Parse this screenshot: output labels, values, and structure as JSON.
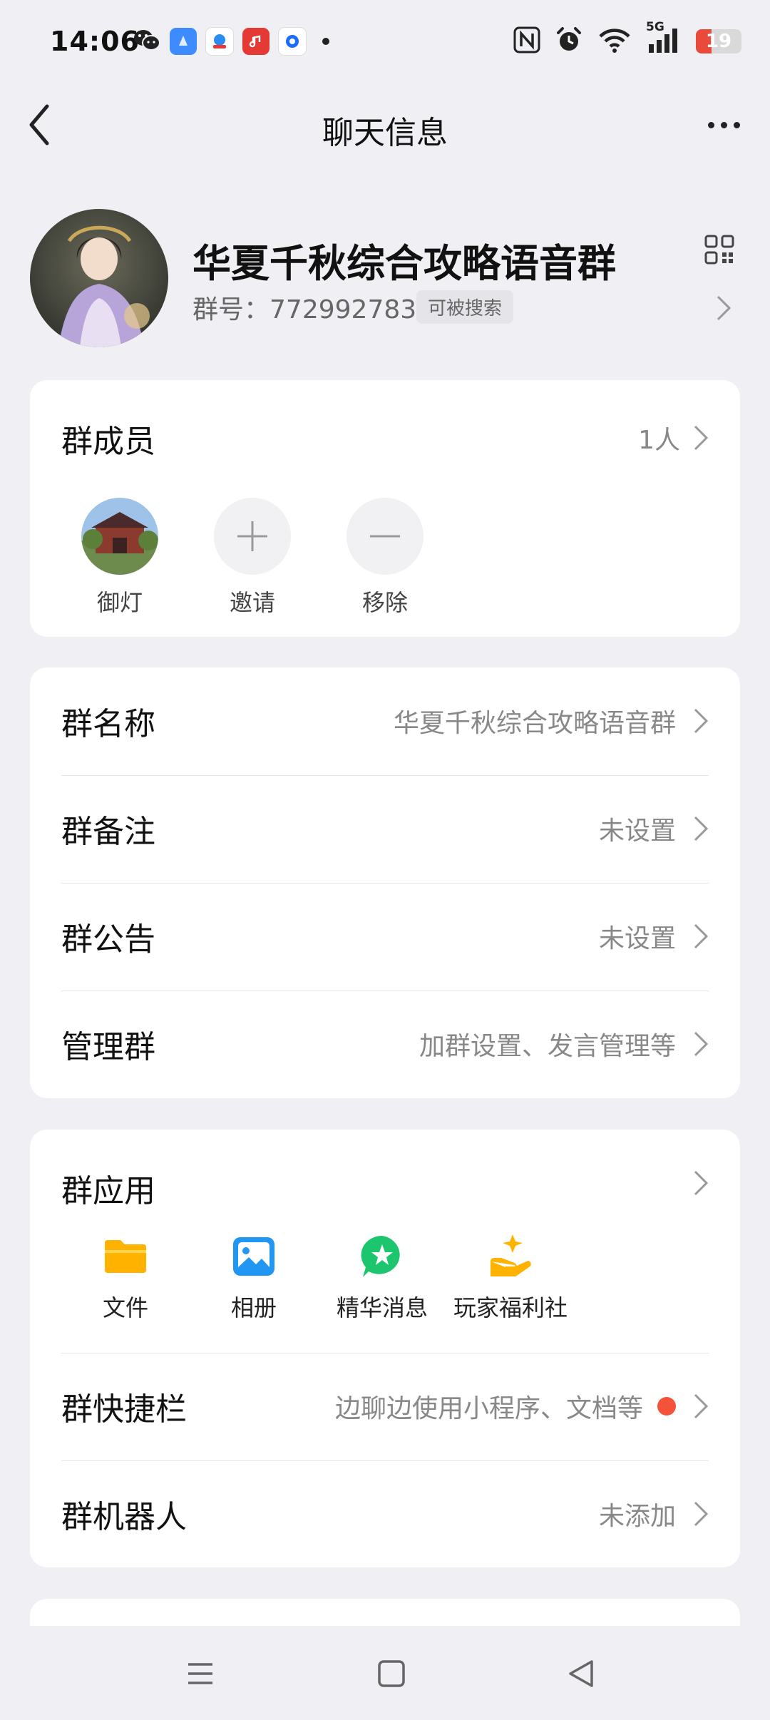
{
  "status_bar": {
    "time": "14:06",
    "network": "5G",
    "battery": "19"
  },
  "nav": {
    "title": "聊天信息"
  },
  "group": {
    "name": "华夏千秋综合攻略语音群",
    "id_label": "群号：",
    "id": "772992783",
    "searchable_badge": "可被搜索"
  },
  "members": {
    "title": "群成员",
    "count": "1人",
    "items": [
      {
        "label": "御灯"
      },
      {
        "label": "邀请"
      },
      {
        "label": "移除"
      }
    ]
  },
  "info": {
    "rows": [
      {
        "label": "群名称",
        "value": "华夏千秋综合攻略语音群"
      },
      {
        "label": "群备注",
        "value": "未设置"
      },
      {
        "label": "群公告",
        "value": "未设置"
      },
      {
        "label": "管理群",
        "value": "加群设置、发言管理等"
      }
    ]
  },
  "apps": {
    "title": "群应用",
    "items": [
      {
        "label": "文件",
        "icon": "folder-icon",
        "color": "#FFB300"
      },
      {
        "label": "相册",
        "icon": "photo-album-icon",
        "color": "#2196F3"
      },
      {
        "label": "精华消息",
        "icon": "star-message-icon",
        "color": "#1DC56E"
      },
      {
        "label": "玩家福利社",
        "icon": "gift-hand-icon",
        "color": "#FFB300"
      }
    ],
    "rows": [
      {
        "label": "群快捷栏",
        "value": "边聊边使用小程序、文档等"
      },
      {
        "label": "群机器人",
        "value": "未添加"
      }
    ]
  },
  "colors": {
    "background": "#EFEFF4",
    "card": "#FFFFFF",
    "accent_red": "#F4533A"
  }
}
